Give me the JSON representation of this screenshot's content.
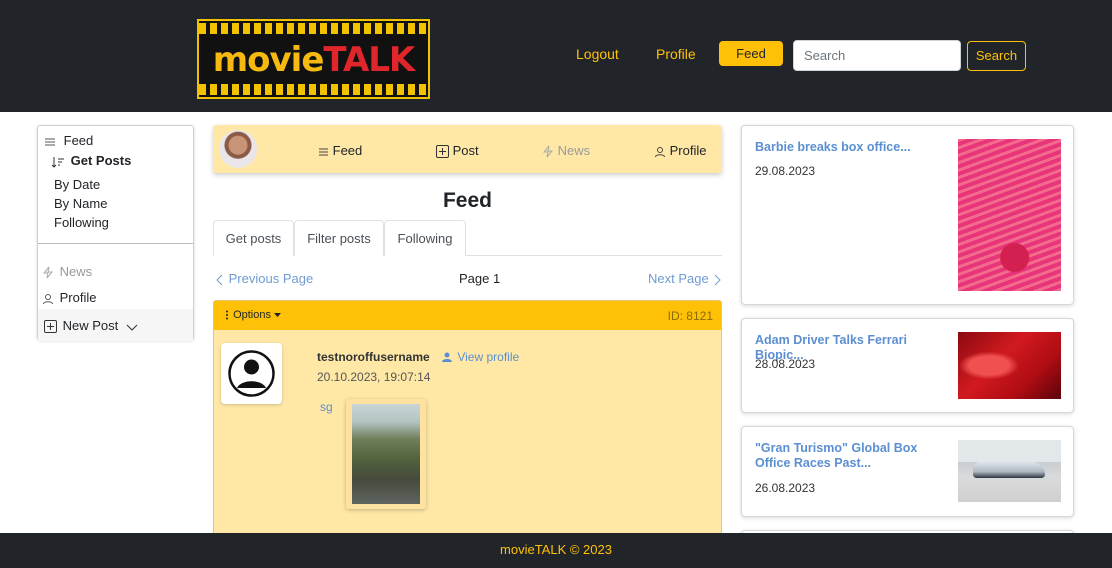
{
  "header": {
    "logo_text_a": "movie",
    "logo_text_b": "TALK",
    "nav": {
      "logout": "Logout",
      "profile": "Profile",
      "feed": "Feed"
    },
    "search": {
      "placeholder": "Search",
      "button": "Search"
    }
  },
  "sidebar": {
    "feed": "Feed",
    "get_posts": "Get Posts",
    "by_date": "By Date",
    "by_name": "By Name",
    "following": "Following",
    "news": "News",
    "profile": "Profile",
    "new_post": "New Post"
  },
  "mini_nav": {
    "feed": "Feed",
    "post": "Post",
    "news": "News",
    "profile": "Profile"
  },
  "main": {
    "title": "Feed",
    "tabs": [
      "Get posts",
      "Filter posts",
      "Following"
    ],
    "pager": {
      "prev": "Previous Page",
      "page": "Page 1",
      "next": "Next Page"
    }
  },
  "post": {
    "options": "Options",
    "id": "ID: 8121",
    "username": "testnoroffusername",
    "view_profile": "View profile",
    "date": "20.10.2023, 19:07:14",
    "text": "sg"
  },
  "news": [
    {
      "title": "Barbie breaks box office...",
      "date": "29.08.2023"
    },
    {
      "title": "Adam Driver Talks Ferrari Biopic...",
      "date": "28.08.2023"
    },
    {
      "title": "\"Gran Turismo\" Global Box Office Races Past...",
      "date": "26.08.2023"
    }
  ],
  "footer": {
    "text": "movieTALK © 2023"
  },
  "colors": {
    "accent": "#ffc107",
    "dark": "#212529",
    "card": "#ffe8a6",
    "link": "#5b8fd1"
  }
}
